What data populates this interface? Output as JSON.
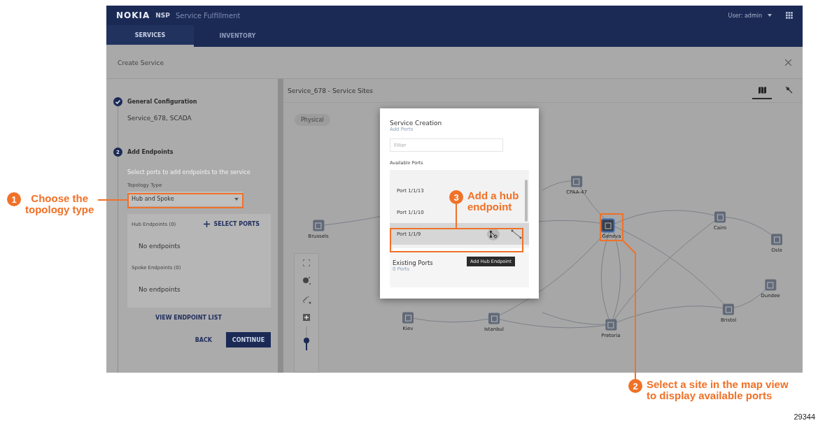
{
  "header": {
    "brand": "NOKIA",
    "product": "NSP",
    "app": "Service Fulfillment",
    "user": "User: admin"
  },
  "tabs": [
    {
      "label": "SERVICES",
      "selected": true
    },
    {
      "label": "INVENTORY",
      "selected": false
    }
  ],
  "page_title": "Create Service",
  "wizard": {
    "steps": [
      {
        "kind": "done",
        "title": "General Configuration",
        "summary": "Service_678, SCADA"
      },
      {
        "kind": "current",
        "number": "2",
        "title": "Add Endpoints",
        "hint": "Select ports to add endpoints to the service",
        "topology_label": "Topology Type",
        "topology_value": "Hub and Spoke",
        "hub_label": "Hub Endpoints (0)",
        "select_ports": "SELECT PORTS",
        "hub_empty": "No endpoints",
        "spoke_label": "Spoke Endpoints (0)",
        "spoke_empty": "No endpoints",
        "view_list": "VIEW ENDPOINT LIST",
        "back": "BACK",
        "continue": "CONTINUE"
      }
    ]
  },
  "map": {
    "title": "Service_678 - Service Sites",
    "view_chip": "Physical",
    "view_toggle": [
      {
        "kind": "map",
        "selected": true
      },
      {
        "kind": "topology",
        "selected": false
      }
    ],
    "sites": [
      {
        "name": "CPAA-47",
        "selected": false
      },
      {
        "name": "Brussels",
        "selected": false
      },
      {
        "name": "Geneva",
        "selected": true
      },
      {
        "name": "Cairo",
        "selected": false
      },
      {
        "name": "Oslo",
        "selected": false
      },
      {
        "name": "Dundee",
        "selected": false
      },
      {
        "name": "Bristol",
        "selected": false
      },
      {
        "name": "Pretoria",
        "selected": false
      },
      {
        "name": "Istanbul",
        "selected": false
      },
      {
        "name": "Kiev",
        "selected": false
      }
    ]
  },
  "dialog": {
    "title": "Service Creation",
    "subtitle": "Add Ports",
    "filter_placeholder": "Filter",
    "available_label": "Available Ports",
    "ports": [
      {
        "name": "Port 1/1/13",
        "highlighted": false
      },
      {
        "name": "Port 1/1/10",
        "highlighted": false
      },
      {
        "name": "Port 1/1/9",
        "highlighted": true
      }
    ],
    "tooltip": "Add Hub Endpoint",
    "existing_title": "Existing Ports",
    "existing_count": "0 Ports"
  },
  "callouts": [
    {
      "number": "1",
      "text": "Choose the\ntopology type"
    },
    {
      "number": "2",
      "text": "Select a site in the map view\nto display available ports"
    },
    {
      "number": "3",
      "text": "Add a hub\nendpoint"
    }
  ],
  "figure_number": "29344"
}
